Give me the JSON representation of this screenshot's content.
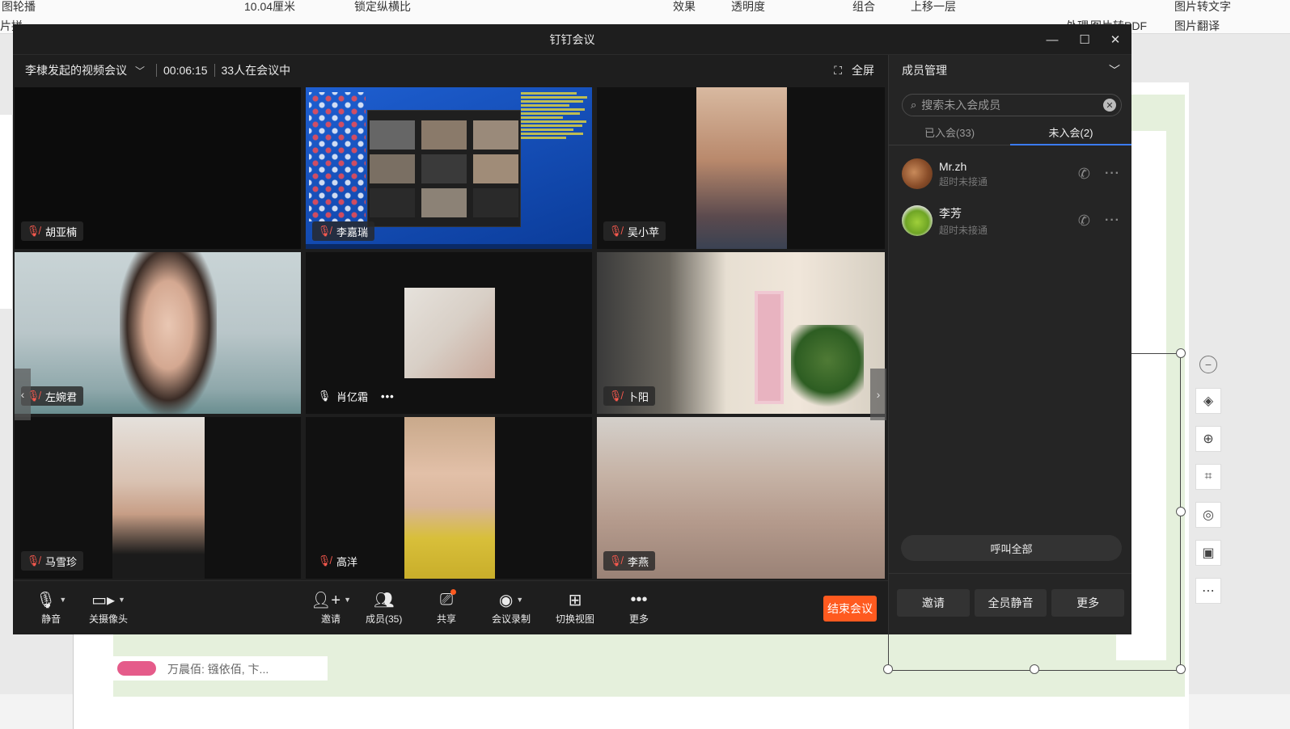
{
  "background_app": {
    "ribbon_top": [
      "图轮播",
      "10.04厘米",
      "锁定纵横比",
      "效果",
      "透明度",
      "组合",
      "上移一层",
      "图片转文字"
    ],
    "ribbon_second": [
      "片拼",
      "处理",
      "图片转PDF",
      "图片翻译"
    ],
    "note_text": "万晨佰: 镪依佰, 卞..."
  },
  "window": {
    "title": "钉钉会议",
    "controls": {
      "minimize": "—",
      "maximize": "☐",
      "close": "✕"
    }
  },
  "meeting": {
    "name": "李棣发起的视频会议",
    "elapsed": "00:06:15",
    "in_meeting": "33人在会议中",
    "fullscreen_label": "全屏"
  },
  "participants": [
    {
      "name": "胡亚楠",
      "mic": "muted"
    },
    {
      "name": "李嘉瑞",
      "mic": "muted",
      "sharing": true
    },
    {
      "name": "吴小苹",
      "mic": "muted"
    },
    {
      "name": "左婉君",
      "mic": "muted"
    },
    {
      "name": "肖亿霜",
      "mic": "on",
      "more": "•••"
    },
    {
      "name": "卜阳",
      "mic": "muted"
    },
    {
      "name": "马雪珍",
      "mic": "muted"
    },
    {
      "name": "高洋",
      "mic": "muted"
    },
    {
      "name": "李燕",
      "mic": "muted"
    }
  ],
  "toolbar": {
    "mute": "静音",
    "camera_off": "关摄像头",
    "invite": "邀请",
    "members": "成员(35)",
    "share": "共享",
    "record": "会议录制",
    "switch_view": "切换视图",
    "more": "更多",
    "end": "结束会议"
  },
  "panel": {
    "title": "成员管理",
    "search_placeholder": "搜索未入会成员",
    "tabs": [
      {
        "label": "已入会(33)",
        "active": false
      },
      {
        "label": "未入会(2)",
        "active": true
      }
    ],
    "members": [
      {
        "name": "Mr.zh",
        "status": "超时未接通"
      },
      {
        "name": "李芳",
        "status": "超时未接通"
      }
    ],
    "call_all": "呼叫全部",
    "buttons": {
      "invite": "邀请",
      "mute_all": "全员静音",
      "more": "更多"
    }
  },
  "colors": {
    "accent_blue": "#3b7bf6",
    "end_button": "#ff5a1f",
    "muted_mic": "#ff5a4f",
    "window_bg": "#1e1e1e"
  }
}
